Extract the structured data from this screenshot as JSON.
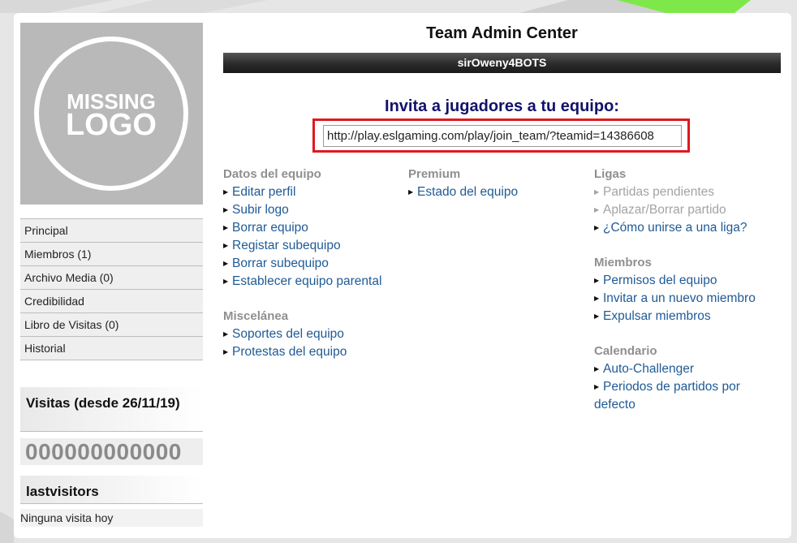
{
  "colors": {
    "link": "#1f5a96",
    "heading": "#12126a",
    "highlight_border": "#e0191f",
    "section_title": "#8f8f8f",
    "accent_stripe": "#7ee84a"
  },
  "logo": {
    "line1": "MISSING",
    "line2": "LOGO"
  },
  "sidebar": {
    "items": [
      {
        "label": "Principal"
      },
      {
        "label": "Miembros (1)"
      },
      {
        "label": "Archivo Media (0)"
      },
      {
        "label": "Credibilidad"
      },
      {
        "label": "Libro de Visitas (0)"
      },
      {
        "label": "Historial"
      }
    ],
    "visits_title": "Visitas (desde 26/11/19)",
    "visits_count": "000000000000",
    "last_title": "lastvisitors",
    "last_empty": "Ninguna visita hoy"
  },
  "main": {
    "title": "Team Admin Center",
    "team_name": "sirOweny4BOTS",
    "invite_heading": "Invita a jugadores a tu equipo:",
    "invite_url": "http://play.eslgaming.com/play/join_team/?teamid=14386608"
  },
  "menus": {
    "datos": {
      "title": "Datos del equipo",
      "links": [
        "Editar perfil",
        "Subir logo",
        "Borrar equipo",
        "Registar subequipo",
        "Borrar subequipo",
        "Establecer equipo parental"
      ]
    },
    "misc": {
      "title": "Miscelánea",
      "links": [
        "Soportes del equipo",
        "Protestas del equipo"
      ]
    },
    "premium": {
      "title": "Premium",
      "links": [
        "Estado del equipo"
      ]
    },
    "ligas": {
      "title": "Ligas",
      "links": [
        "Partidas pendientes",
        "Aplazar/Borrar partido",
        "¿Cómo unirse a una liga?"
      ]
    },
    "miembros": {
      "title": "Miembros",
      "links": [
        "Permisos del equipo",
        "Invitar a un nuevo miembro",
        "Expulsar miembros"
      ]
    },
    "calendario": {
      "title": "Calendario",
      "links": [
        "Auto-Challenger",
        "Periodos de partidos por defecto"
      ]
    }
  }
}
